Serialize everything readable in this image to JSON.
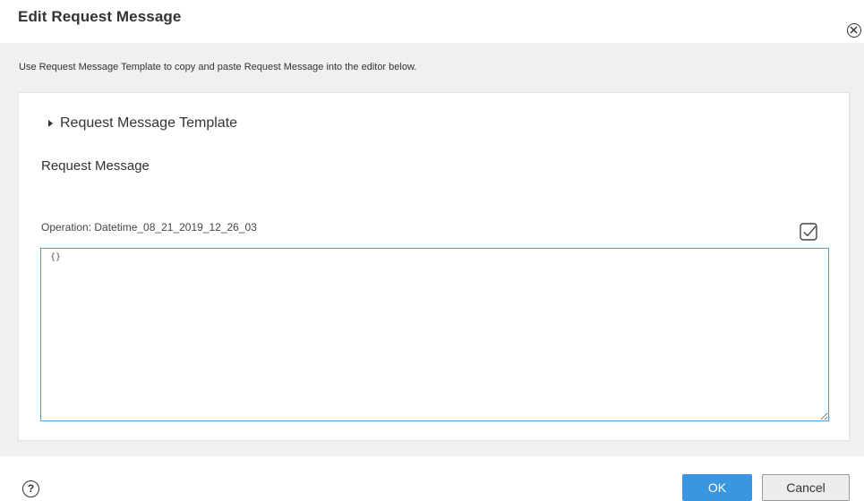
{
  "dialog": {
    "title": "Edit Request Message",
    "instructions": "Use Request Message Template to copy and paste Request Message into the editor below."
  },
  "panel": {
    "template_label": "Request Message Template",
    "section_label": "Request Message",
    "operation_text": "Operation:  Datetime_08_21_2019_12_26_03",
    "editor_value": "{}"
  },
  "footer": {
    "help_label": "?",
    "ok_label": "OK",
    "cancel_label": "Cancel"
  },
  "colors": {
    "accent": "#3a96e0",
    "editor_border": "#4ea2e0",
    "background_gray": "#f0f0f0"
  },
  "icons": {
    "close": "close-circle-icon",
    "expand": "caret-right-icon",
    "validate": "checkbox-check-icon",
    "help": "help-circle-icon"
  }
}
